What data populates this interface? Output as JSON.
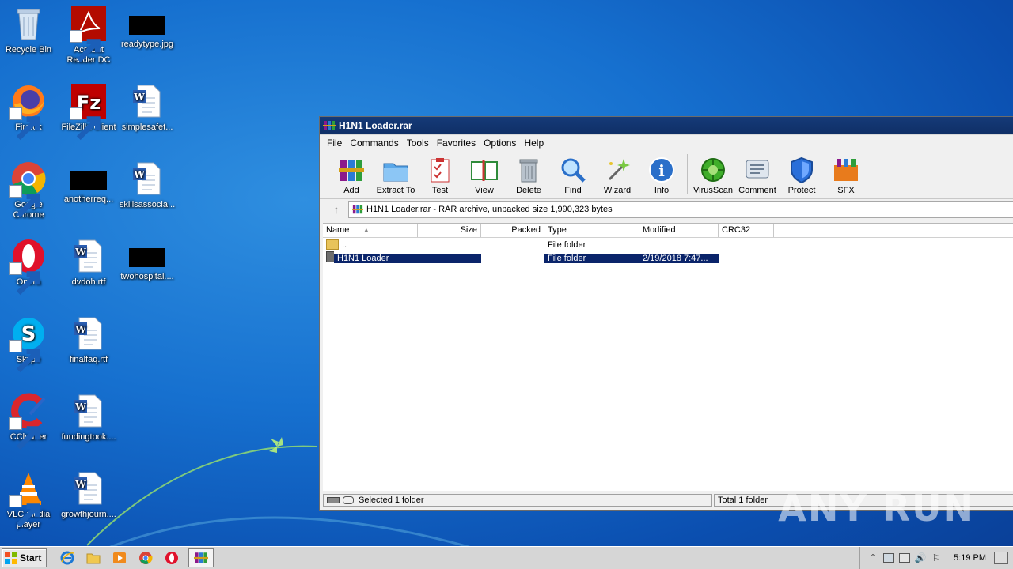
{
  "desktop": {
    "icons": [
      {
        "label": "Recycle Bin",
        "icon": "recycle-bin-icon"
      },
      {
        "label": "Acrobat Reader DC",
        "icon": "acrobat-icon"
      },
      {
        "label": "readytype.jpg",
        "icon": "image-file-icon"
      },
      {
        "label": "Firefox",
        "icon": "firefox-icon"
      },
      {
        "label": "FileZilla Client",
        "icon": "filezilla-icon"
      },
      {
        "label": "simplesafet...",
        "icon": "word-doc-icon"
      },
      {
        "label": "Google Chrome",
        "icon": "chrome-icon"
      },
      {
        "label": "anotherreq...",
        "icon": "image-file-icon"
      },
      {
        "label": "skillsassocia...",
        "icon": "word-doc-icon"
      },
      {
        "label": "Opera",
        "icon": "opera-icon"
      },
      {
        "label": "dvdoh.rtf",
        "icon": "word-doc-icon"
      },
      {
        "label": "twohospital....",
        "icon": "image-file-icon"
      },
      {
        "label": "Skype",
        "icon": "skype-icon"
      },
      {
        "label": "finalfaq.rtf",
        "icon": "word-doc-icon"
      },
      {
        "label": "CCleaner",
        "icon": "ccleaner-icon"
      },
      {
        "label": "fundingtook....",
        "icon": "word-doc-icon"
      },
      {
        "label": "VLC media player",
        "icon": "vlc-icon"
      },
      {
        "label": "growthjourn....",
        "icon": "word-doc-icon"
      }
    ]
  },
  "window": {
    "title": "H1N1 Loader.rar",
    "menu": [
      "File",
      "Commands",
      "Tools",
      "Favorites",
      "Options",
      "Help"
    ],
    "toolbar": [
      {
        "label": "Add",
        "icon": "add-archive-icon"
      },
      {
        "label": "Extract To",
        "icon": "extract-folder-icon"
      },
      {
        "label": "Test",
        "icon": "test-clipboard-icon"
      },
      {
        "label": "View",
        "icon": "view-book-icon"
      },
      {
        "label": "Delete",
        "icon": "trash-icon"
      },
      {
        "label": "Find",
        "icon": "magnifier-icon"
      },
      {
        "label": "Wizard",
        "icon": "wizard-wand-icon"
      },
      {
        "label": "Info",
        "icon": "info-icon"
      },
      {
        "label": "VirusScan",
        "icon": "virus-scan-icon"
      },
      {
        "label": "Comment",
        "icon": "comment-icon"
      },
      {
        "label": "Protect",
        "icon": "shield-icon"
      },
      {
        "label": "SFX",
        "icon": "sfx-icon"
      }
    ],
    "address": "H1N1 Loader.rar - RAR archive, unpacked size 1,990,323 bytes",
    "columns": [
      "Name",
      "Size",
      "Packed",
      "Type",
      "Modified",
      "CRC32"
    ],
    "rows": [
      {
        "name": "..",
        "size": "",
        "packed": "",
        "type": "File folder",
        "modified": "",
        "crc": ""
      },
      {
        "name": "H1N1 Loader",
        "size": "",
        "packed": "",
        "type": "File folder",
        "modified": "2/19/2018 7:47...",
        "crc": ""
      }
    ],
    "status_left": "Selected 1 folder",
    "status_right": "Total 1 folder"
  },
  "taskbar": {
    "start_label": "Start",
    "clock": "5:19 PM"
  },
  "watermark": "ANY RUN"
}
